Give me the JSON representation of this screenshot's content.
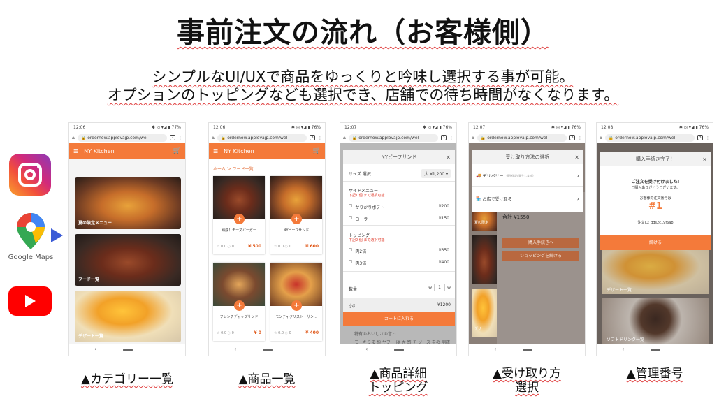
{
  "title": "事前注文の流れ（お客様側）",
  "subtitle_lines": [
    "シンプルなUI/UXで商品をゆっくりと吟味し選択する事が可能。",
    "オプションのトッピングなども選択でき、店舗での待ち時間がなくなります。"
  ],
  "logos": {
    "instagram": "instagram-icon",
    "google_maps_label": "Google Maps",
    "youtube": "youtube-icon"
  },
  "colors": {
    "accent": "#f47a3a",
    "arrow": "#3b5bd6",
    "underline": "#e04040"
  },
  "url_text": "ordernow.applovajp.com/wel",
  "phone1": {
    "time": "12:06",
    "battery": "77%",
    "store": "NY Kitchen",
    "cart_count": "0",
    "categories": [
      "夏の限定メニュー",
      "フード一覧",
      "デザート一覧"
    ]
  },
  "phone2": {
    "time": "12:06",
    "battery": "76%",
    "store": "NY Kitchen",
    "breadcrumb": "ホーム ＞ フード一覧",
    "products": [
      {
        "name": "熟成！チーズバーガー",
        "rating": "☆ 0.0 ◌ 0",
        "price": "¥ 500"
      },
      {
        "name": "NYビーフサンド",
        "rating": "☆ 0.0 ◌ 0",
        "price": "¥ 600"
      },
      {
        "name": "フレンチディップサンド",
        "rating": "☆ 0.0 ◌ 0",
        "price": "¥ 0"
      },
      {
        "name": "モンティクリスト・サン...",
        "rating": "☆ 0.0 ◌ 0",
        "price": "¥ 400"
      }
    ]
  },
  "phone3": {
    "time": "12:07",
    "battery": "76%",
    "modal_title": "NYビーフサンド",
    "size_label": "サイズ 選択",
    "size_value": "大 ¥1,200 ▾",
    "side_title": "サイドメニュー",
    "side_note": "下記1 個 まで選択可能",
    "sides": [
      {
        "name": "かりかりポテト",
        "price": "¥200"
      },
      {
        "name": "コーラ",
        "price": "¥150"
      }
    ],
    "topping_title": "トッピング",
    "topping_note": "下記2 個 まで選択可能",
    "toppings": [
      {
        "name": "肉2倍",
        "price": "¥350"
      },
      {
        "name": "肉3倍",
        "price": "¥400"
      }
    ],
    "qty_label": "数量",
    "qty_value": "1",
    "subtotal_label": "小計",
    "subtotal_value": "¥1200",
    "add_to_cart": "カートに入れる",
    "bg_text_1": "特有のおいしさの言っ",
    "bg_text_2": "モーキりま 約 ヤフ ーは 大 感 チ ソース をの 明確"
  },
  "phone4": {
    "time": "12:07",
    "battery": "76%",
    "modal_title": "受け取り方法の選択",
    "delivery_label": "デリバリー",
    "delivery_note": "(配送料が発生します)",
    "pickup_label": "お店で受け取る",
    "bg_label": "夏の限定",
    "bg_total": "合計 ¥1550",
    "bg_btn1": "購入手続きへ",
    "bg_btn2": "ショッピングを続ける",
    "bg_cat": "デザ"
  },
  "phone5": {
    "time": "12:08",
    "battery": "76%",
    "modal_title": "購入手続き完了！",
    "line1": "ご注文を受け付けました!",
    "line2": "ご購入ありがとうございます。",
    "number_label": "お客様の注文番号は",
    "number": "#1",
    "order_id": "注文ID: dgs2c19f6ab",
    "continue_label": "続ける",
    "bg_cat1": "デザート一覧",
    "bg_cat2": "ソフトドリンク一覧"
  },
  "captions": [
    "▲カテゴリー一覧",
    "▲商品一覧",
    "▲商品詳細",
    "トッピング",
    "▲受け取り方",
    "選択",
    "▲管理番号"
  ]
}
